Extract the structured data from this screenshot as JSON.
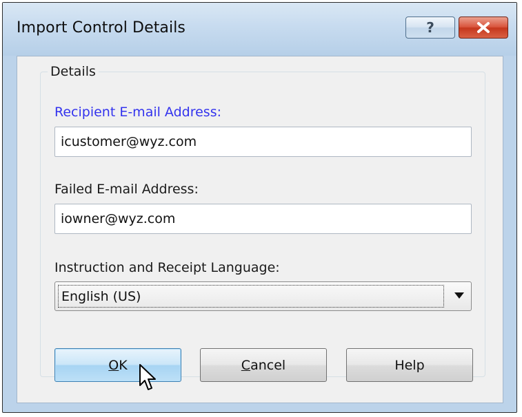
{
  "window": {
    "title": "Import Control Details",
    "help_glyph": "?",
    "close_glyph": "x"
  },
  "group": {
    "label": "Details"
  },
  "fields": {
    "recipient_label": "Recipient E-mail Address:",
    "recipient_value": "icustomer@wyz.com",
    "failed_label": "Failed E-mail Address:",
    "failed_value": "iowner@wyz.com",
    "language_label": "Instruction and Receipt Language:",
    "language_value": "English (US)"
  },
  "buttons": {
    "ok_mnemonic": "O",
    "ok_rest": "K",
    "cancel_mnemonic": "C",
    "cancel_rest": "ancel",
    "help": "Help"
  },
  "colors": {
    "titlebar": "#c7dbef",
    "label_highlight": "#3333ee",
    "close_button": "#d9543c",
    "default_button": "#a7d4f3"
  }
}
